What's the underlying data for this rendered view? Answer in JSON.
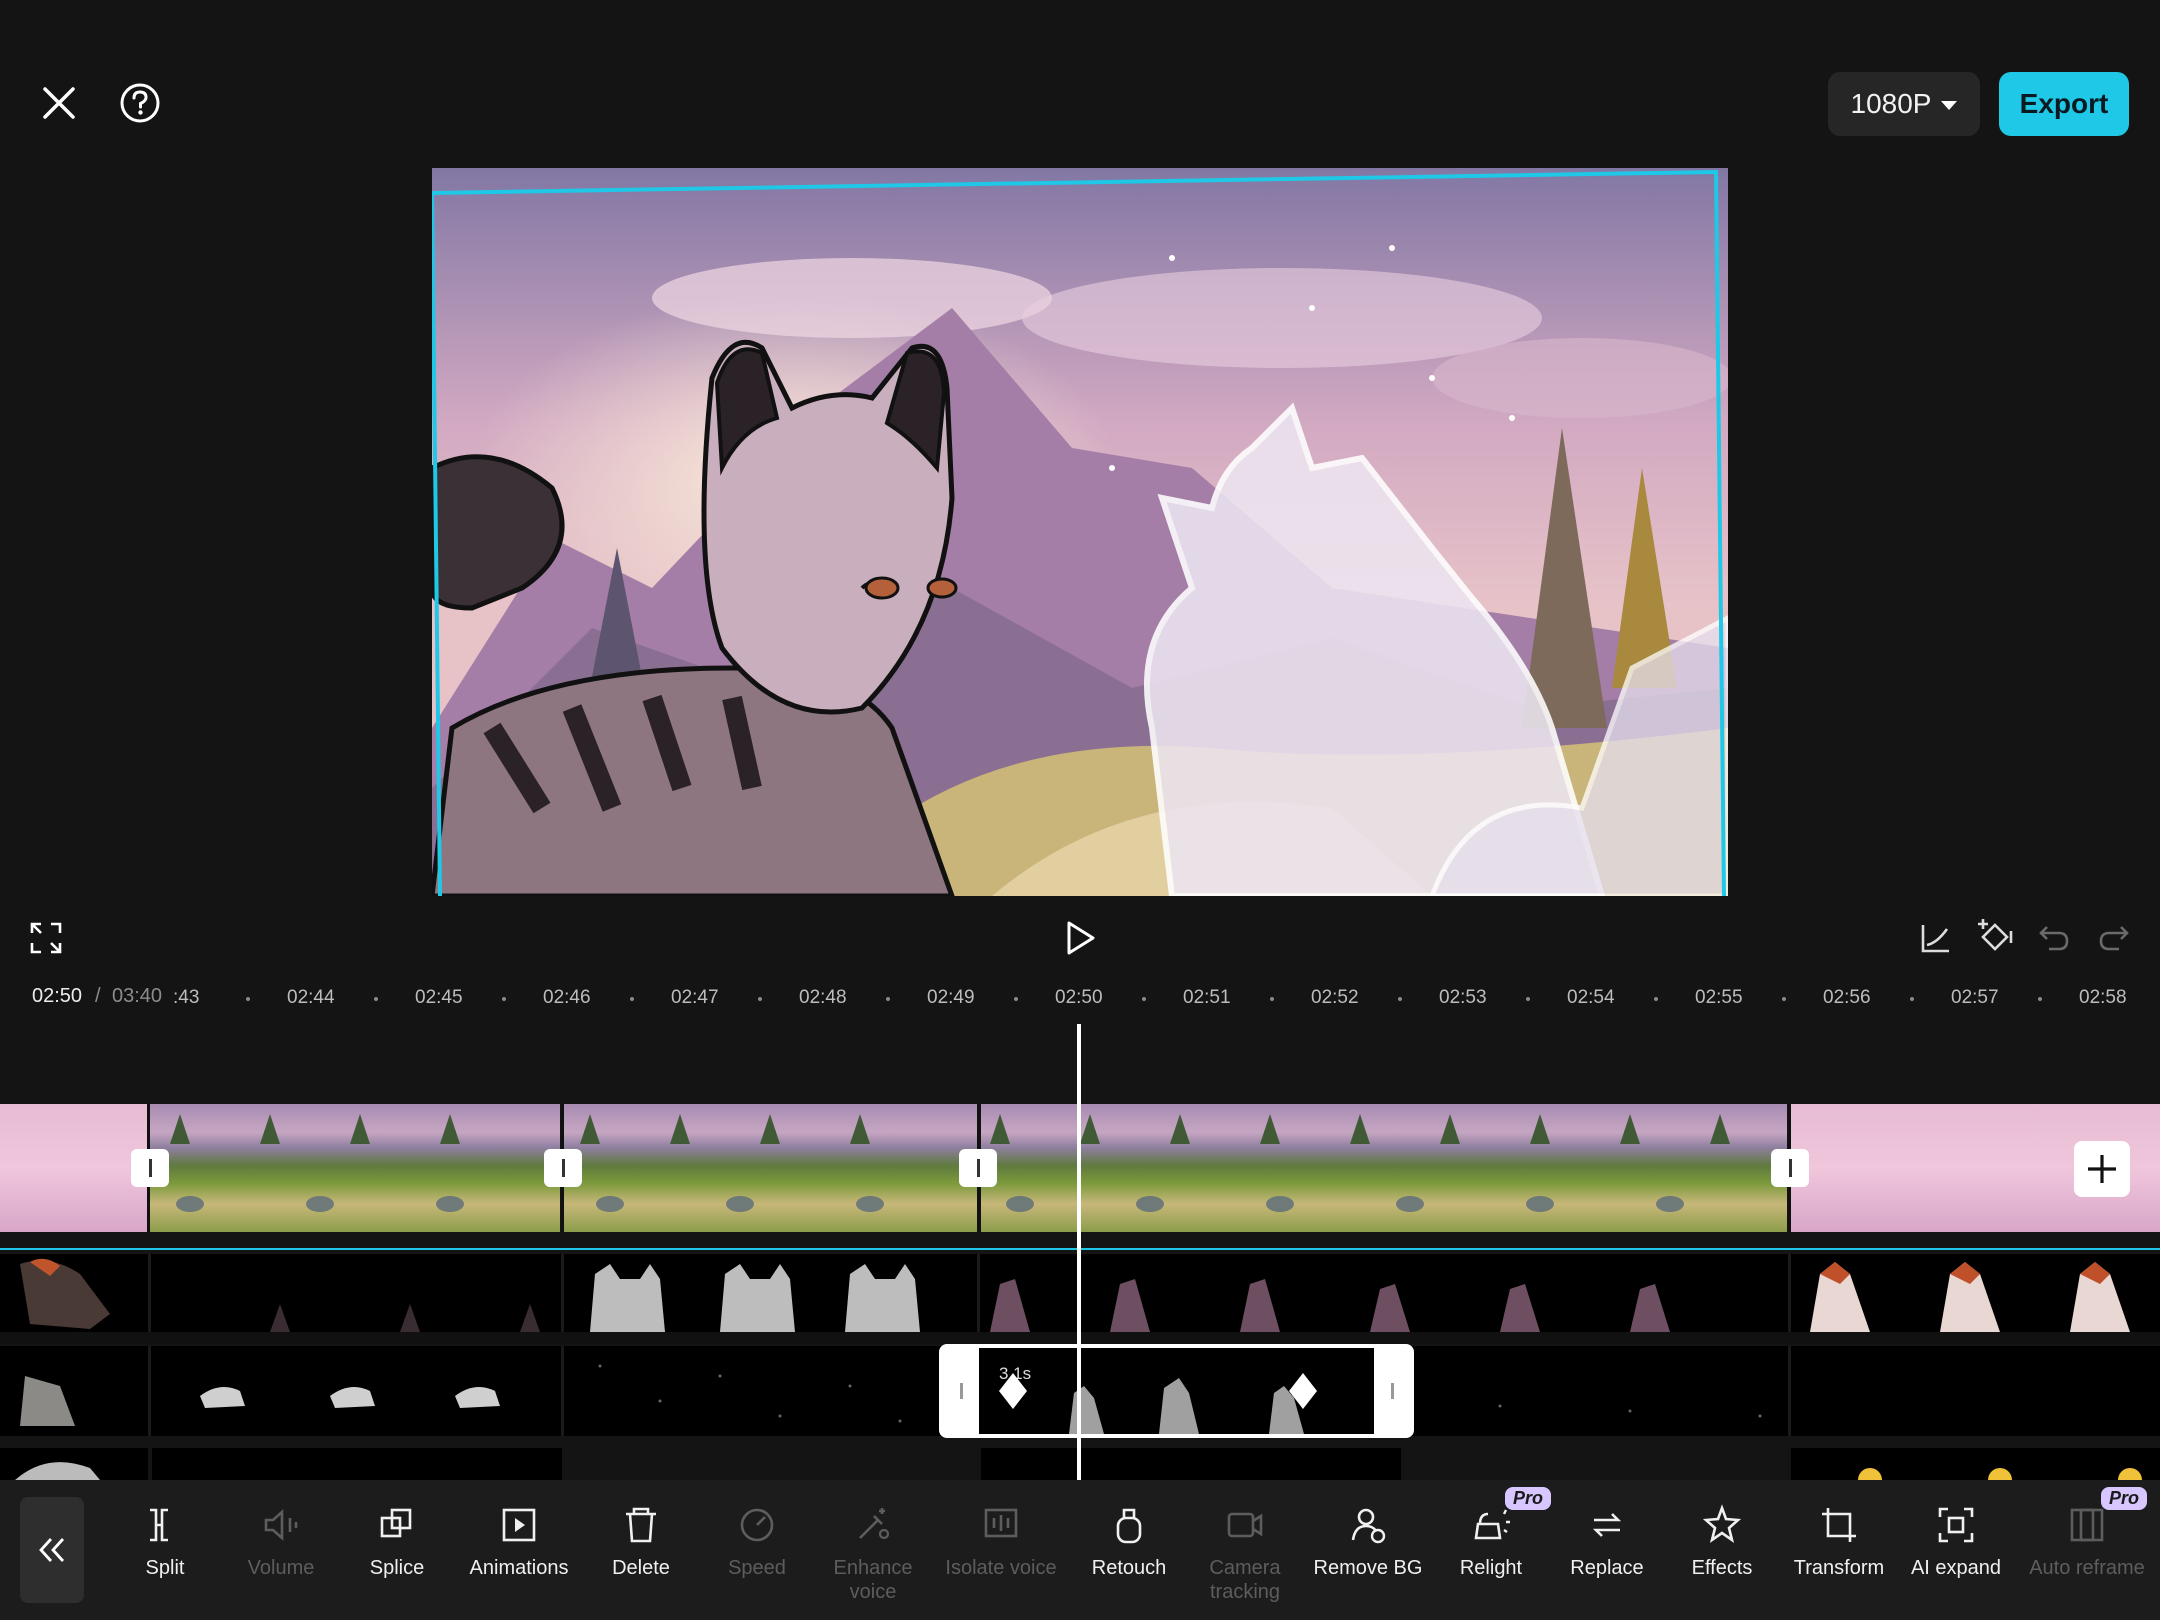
{
  "header": {
    "resolution": "1080P",
    "export_label": "Export"
  },
  "playback": {
    "current_time": "02:50",
    "separator": "/",
    "total_time": "03:40"
  },
  "ruler": {
    "first_partial": ":43",
    "ticks": [
      "02:44",
      "02:45",
      "02:46",
      "02:47",
      "02:48",
      "02:49",
      "02:50",
      "02:51",
      "02:52",
      "02:53",
      "02:54",
      "02:55",
      "02:56",
      "02:57",
      "02:58"
    ]
  },
  "selected_clip": {
    "duration_label": "3.1s"
  },
  "toolbar": {
    "tools": [
      {
        "label": "Split",
        "icon": "split-icon",
        "enabled": true
      },
      {
        "label": "Volume",
        "icon": "volume-icon",
        "enabled": false
      },
      {
        "label": "Splice",
        "icon": "splice-icon",
        "enabled": true
      },
      {
        "label": "Animations",
        "icon": "animations-icon",
        "enabled": true
      },
      {
        "label": "Delete",
        "icon": "delete-icon",
        "enabled": true
      },
      {
        "label": "Speed",
        "icon": "speed-icon",
        "enabled": false
      },
      {
        "label": "Enhance voice",
        "icon": "enhance-voice-icon",
        "enabled": false
      },
      {
        "label": "Isolate voice",
        "icon": "isolate-voice-icon",
        "enabled": false
      },
      {
        "label": "Retouch",
        "icon": "retouch-icon",
        "enabled": true
      },
      {
        "label": "Camera tracking",
        "icon": "camera-tracking-icon",
        "enabled": false
      },
      {
        "label": "Remove BG",
        "icon": "remove-bg-icon",
        "enabled": true
      },
      {
        "label": "Relight",
        "icon": "relight-icon",
        "enabled": true,
        "badge": "Pro"
      },
      {
        "label": "Replace",
        "icon": "replace-icon",
        "enabled": true
      },
      {
        "label": "Effects",
        "icon": "effects-icon",
        "enabled": true
      },
      {
        "label": "Transform",
        "icon": "transform-icon",
        "enabled": true
      },
      {
        "label": "AI expand",
        "icon": "ai-expand-icon",
        "enabled": true
      },
      {
        "label": "Auto reframe",
        "icon": "auto-reframe-icon",
        "enabled": false,
        "badge": "Pro"
      }
    ]
  },
  "colors": {
    "accent": "#1ec8e6",
    "background": "#141414",
    "toolbar": "#1c1c1c",
    "pro_badge": "#d7c6ff"
  }
}
